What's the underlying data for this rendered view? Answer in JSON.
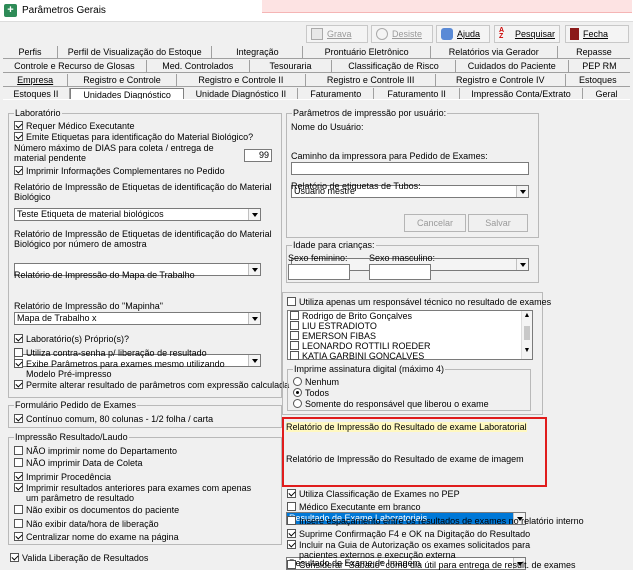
{
  "window": {
    "title": "Parâmetros Gerais"
  },
  "toolbar": {
    "grava": "Grava",
    "desiste": "Desiste",
    "ajuda": "Ajuda",
    "pesquisar": "Pesquisar",
    "fecha": "Fecha"
  },
  "tabs": {
    "row1": [
      "Perfis",
      "Perfil de Visualização do Estoque",
      "Integração",
      "Prontuário Eletrônico",
      "Relatórios via Gerador",
      "Repasse"
    ],
    "row2": [
      "Controle e Recurso de Glosas",
      "Med. Controlados",
      "Tesouraria",
      "Classificação de Risco",
      "Cuidados do Paciente",
      "PEP RM"
    ],
    "row3": [
      "Empresa",
      "Registro e Controle",
      "Registro e Controle II",
      "Registro e Controle III",
      "Registro e Controle IV",
      "Estoques"
    ],
    "row4": [
      "Estoques II",
      "Unidades Diagnóstico",
      "Unidade Diagnóstico II",
      "Faturamento",
      "Faturamento II",
      "Impressão Conta/Extrato",
      "Geral"
    ]
  },
  "laboratorio": {
    "title": "Laboratório",
    "requer_medico": "Requer Médico Executante",
    "emite_etiquetas": "Emite Etiquetas para identificação do Material Biológico?",
    "num_dias_label": "Número máximo de DIAS para coleta / entrega de material pendente",
    "num_dias_value": "99",
    "imprimir_info": "Imprimir Informações Complementares no Pedido",
    "rel_etiquetas_label": "Relatório de Impressão de Etiquetas de identificação do Material Biológico",
    "rel_etiquetas_value": "Teste Etiqueta de material biológicos",
    "rel_etiquetas_amostra_label": "Relatório de Impressão de Etiquetas de identificação do Material Biológico por número de amostra",
    "rel_etiquetas_amostra_value": "",
    "rel_mapa_label": "Relatório de Impressão do Mapa de Trabalho",
    "rel_mapa_value": "Mapa de Trabalho x",
    "rel_mapinha_label": "Relatório de Impressão do \"Mapinha\"",
    "rel_mapinha_value": "",
    "lab_proprio": "Laboratório(s) Próprio(s)?",
    "contra_senha": "Utiliza contra-senha p/ liberação de resultado",
    "exibe_parametros": "Exibe Parâmetros para exames mesmo utilizando Modelo Pré-impresso",
    "permite_alterar": "Permite alterar resultado de parâmetros com expressão calculada"
  },
  "formulario": {
    "title": "Formulário Pedido de Exames",
    "continuo": "Contínuo comum, 80 colunas - 1/2 folha / carta"
  },
  "impressao": {
    "title": "Impressão Resultado/Laudo",
    "nao_nome_dep": "NÃO imprimir nome do Departamento",
    "nao_data_coleta": "NÃO imprimir Data de Coleta",
    "imprimir_proc": "Imprimir Procedência",
    "imprimir_anteriores": "Imprimir resultados anteriores para exames com apenas um parâmetro de resultado",
    "nao_exibir_docs": "Não exibir os documentos do paciente",
    "nao_exibir_data": "Não exibir data/hora de liberação",
    "centralizar": "Centralizar nome do exame na página"
  },
  "valida_liberacao": "Valida Liberação de Resultados",
  "param_impressao": {
    "title": "Parâmetros de impressão por usuário:",
    "nome_usuario_label": "Nome do Usuário:",
    "nome_usuario_value": "Usuario mestre",
    "caminho_label": "Caminho da impressora para Pedido de Exames:",
    "caminho_value": "",
    "rel_tubos_label": "Relatório de etiquetas de Tubos:",
    "rel_tubos_value": "",
    "cancelar": "Cancelar",
    "salvar": "Salvar"
  },
  "idade": {
    "title": "Idade para crianças:",
    "feminino_label": "Sexo feminino:",
    "masculino_label": "Sexo masculino:",
    "feminino_value": "",
    "masculino_value": ""
  },
  "responsavel": {
    "utiliza_apenas": "Utiliza apenas um responsável técnico no resultado de exames",
    "list": [
      "Rodrigo de Brito Gonçalves",
      "LIU ESTRADIOTO",
      "EMERSON FIBAS",
      "LEONARDO ROTTILI ROEDER",
      "KATIA GARBINI GONCALVES"
    ]
  },
  "assinatura": {
    "title": "Imprime assinatura digital (máximo 4)",
    "options": [
      "Nenhum",
      "Todos",
      "Somente do responsável que liberou o exame"
    ]
  },
  "rel_resultado": {
    "lab_label": "Relatório de Impressão do Resultado de exame Laboratorial",
    "lab_value": "Resultado de Exame Laboratoriais",
    "img_label": "Relatório de Impressão do Resultado de exame de imagem",
    "img_value": "Resultado de Exame de Imagem"
  },
  "bottom_right": {
    "utiliza_class": "Utiliza Classificação de Exames no PEP",
    "medico_branco": "Médico Executante em branco",
    "insere_espacamento": "Insere espaçamento entre os resultados de exames no relatório interno",
    "suprime_confirmacao": "Suprime Confirmação F4 e OK na Digitação do Resultado",
    "incluir_guia": "Incluir na Guia de Autorização os exames solicitados para pacientes externos e execução externa",
    "considerar_sabado": "Considerar \"Sábado\" como dia útil para entrega de result. de exames"
  },
  "colors": {
    "selection": "#0078d7",
    "highlight_border": "#e01c1c"
  }
}
